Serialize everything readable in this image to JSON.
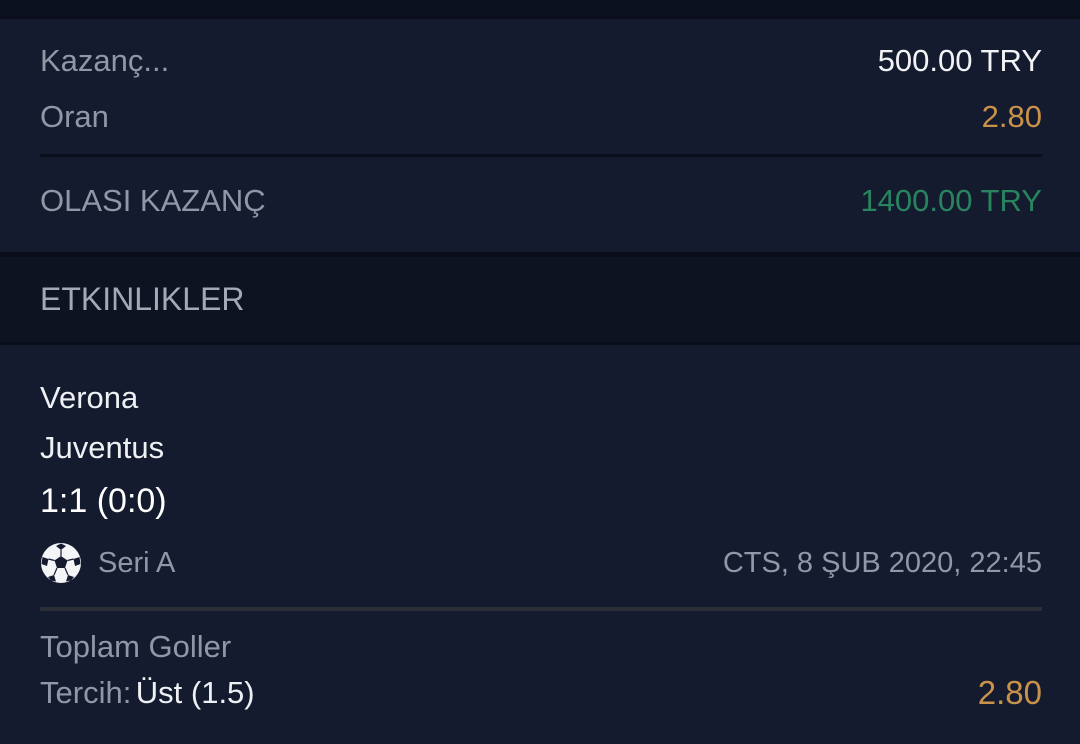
{
  "summary": {
    "stake_label": "Kazanç...",
    "stake_value": "500.00 TRY",
    "odds_label": "Oran",
    "odds_value": "2.80",
    "potential_label": "OLASI KAZANÇ",
    "potential_value": "1400.00 TRY"
  },
  "events_section": {
    "title": "ETKINLIKLER"
  },
  "event": {
    "home_team": "Verona",
    "away_team": "Juventus",
    "score": "1:1 (0:0)",
    "league_icon": "soccer-ball-icon",
    "league": "Seri A",
    "datetime": "CTS, 8 ŞUB 2020, 22:45",
    "market": "Toplam Goller",
    "pick_label": "Tercih:",
    "pick_value": "Üst (1.5)",
    "pick_odds": "2.80"
  },
  "colors": {
    "background": "#151b2e",
    "header_background": "#0e1322",
    "label": "#9097a6",
    "primary_text": "#eef0f4",
    "odds": "#c9924a",
    "win": "#27845f"
  }
}
